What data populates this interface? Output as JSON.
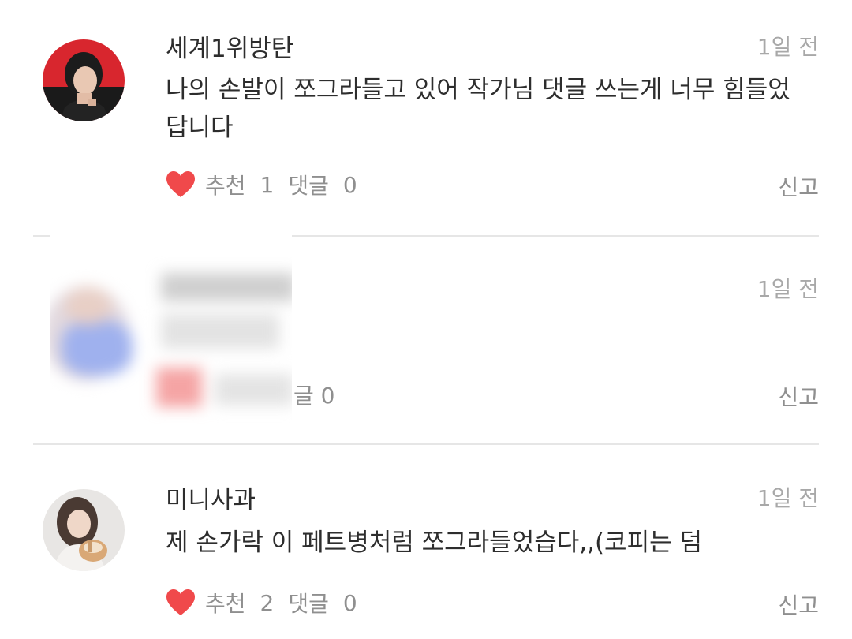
{
  "comments": [
    {
      "username": "세계1위방탄",
      "time": "1일 전",
      "text": "나의 손발이 쪼그라들고 있어 작가님 댓글 쓰는게 너무 힘들었답니다",
      "likes_label": "추천",
      "likes": "1",
      "replies_label": "댓글",
      "replies": "0",
      "report": "신고"
    },
    {
      "username": "",
      "time": "1일 전",
      "text": "",
      "replies_label": "댓글",
      "replies": "0",
      "replies_visible": "글 0",
      "report": "신고"
    },
    {
      "username": "미니사과",
      "time": "1일 전",
      "text": "제 손가락 이 페트병처럼 쪼그라들었습다,,(코피는 덤",
      "likes_label": "추천",
      "likes": "2",
      "replies_label": "댓글",
      "replies": "0",
      "report": "신고"
    }
  ],
  "colors": {
    "heart": "#f0494b",
    "divider": "#e6e6e6",
    "muted_text": "#8f8f8f",
    "time_text": "#a8a8a8",
    "main_text": "#2d2d2d"
  },
  "icons": {
    "like": "heart-icon"
  }
}
